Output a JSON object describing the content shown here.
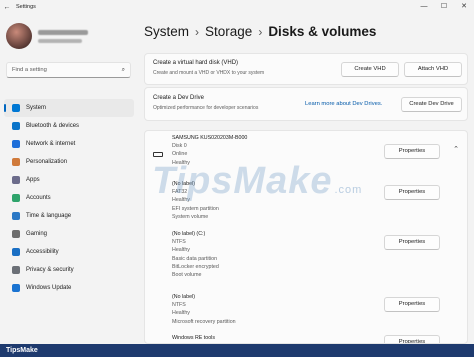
{
  "window": {
    "title": "Settings",
    "back_glyph": "←",
    "minimize_glyph": "—",
    "maximize_glyph": "☐",
    "close_glyph": "✕"
  },
  "sidebar": {
    "search_placeholder": "Find a setting",
    "items": [
      {
        "label": "System",
        "active": true,
        "icon": "system-icon",
        "color": "#0078d4"
      },
      {
        "label": "Bluetooth & devices",
        "icon": "bluetooth-icon",
        "color": "#0a74c9"
      },
      {
        "label": "Network & internet",
        "icon": "wifi-icon",
        "color": "#1e6fd9"
      },
      {
        "label": "Personalization",
        "icon": "brush-icon",
        "color": "#d07a3a"
      },
      {
        "label": "Apps",
        "icon": "apps-icon",
        "color": "#6b6b8a"
      },
      {
        "label": "Accounts",
        "icon": "person-icon",
        "color": "#2ea36b"
      },
      {
        "label": "Time & language",
        "icon": "globe-clock-icon",
        "color": "#2a78c5"
      },
      {
        "label": "Gaming",
        "icon": "controller-icon",
        "color": "#6d6d6d"
      },
      {
        "label": "Accessibility",
        "icon": "accessibility-icon",
        "color": "#1a6fc4"
      },
      {
        "label": "Privacy & security",
        "icon": "shield-icon",
        "color": "#6b6f76"
      },
      {
        "label": "Windows Update",
        "icon": "update-icon",
        "color": "#1a73d1"
      }
    ]
  },
  "breadcrumb": {
    "part1": "System",
    "part2": "Storage",
    "current": "Disks & volumes",
    "sep": "›"
  },
  "vhd_card": {
    "title": "Create a virtual hard disk (VHD)",
    "subtitle": "Create and mount a VHD or VHDX to your system",
    "create_label": "Create VHD",
    "attach_label": "Attach VHD"
  },
  "devdrive_card": {
    "title": "Create a Dev Drive",
    "subtitle": "Optimized performance for developer scenarios",
    "link_label": "Learn more about Dev Drives.",
    "create_label": "Create Dev Drive"
  },
  "disk": {
    "name": "SAMSUNG KUS020203M-B000",
    "line2": "Disk 0",
    "line3": "Online",
    "line4": "Healthy",
    "properties_label": "Properties",
    "chevron_glyph": "⌃"
  },
  "volumes": [
    {
      "lines": [
        "(No label)",
        "FAT32",
        "Healthy",
        "EFI system partition",
        "System volume"
      ],
      "properties_label": "Properties"
    },
    {
      "lines": [
        "(No label) (C:)",
        "NTFS",
        "Healthy",
        "Basic data partition",
        "BitLocker encrypted",
        "Boot volume"
      ],
      "properties_label": "Properties"
    },
    {
      "lines": [
        "(No label)",
        "NTFS",
        "Healthy",
        "Microsoft recovery partition"
      ],
      "properties_label": "Properties"
    },
    {
      "lines": [
        "Windows RE tools"
      ],
      "properties_label": "Properties"
    }
  ],
  "watermark": {
    "text": "TipsMake",
    "domain": ".com"
  },
  "footer": {
    "text": "TipsMake"
  },
  "colors": {
    "accent": "#0067c0",
    "footer_bg": "#1e3a6e",
    "link": "#0058a8"
  }
}
